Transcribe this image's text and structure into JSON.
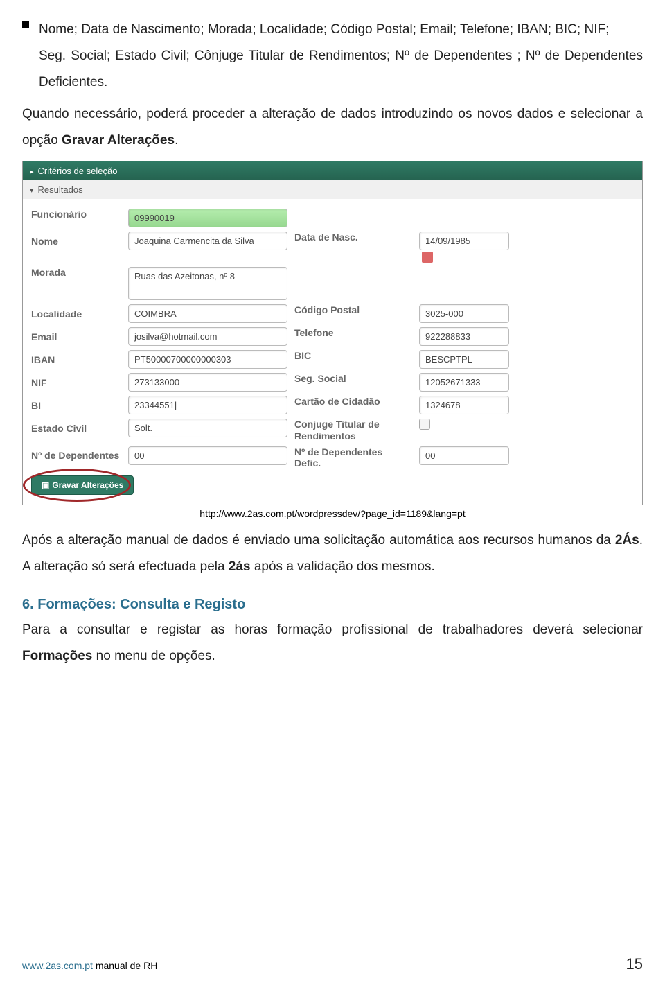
{
  "bullet1_a": "Nome; Data de Nascimento; Morada; Localidade; Código Postal; Email; Telefone; IBAN; BIC; NIF;",
  "bullet1_b": "Seg. Social; Estado Civil; Cônjuge Titular de Rendimentos; Nº de Dependentes ; Nº de Dependentes Deficientes.",
  "para2_a": "Quando necessário, poderá proceder a alteração de dados introduzindo os novos dados e selecionar a opção ",
  "para2_b": "Gravar Alterações",
  "para2_c": ".",
  "ui": {
    "header1": "Critérios de seleção",
    "header2": "Resultados",
    "labels": {
      "funcionario": "Funcionário",
      "nome": "Nome",
      "data_nasc": "Data de Nasc.",
      "morada": "Morada",
      "localidade": "Localidade",
      "cod_postal": "Código Postal",
      "email": "Email",
      "telefone": "Telefone",
      "iban": "IBAN",
      "bic": "BIC",
      "nif": "NIF",
      "seg_social": "Seg. Social",
      "bi": "BI",
      "cartao": "Cartão de Cidadão",
      "estado_civil": "Estado Civil",
      "conjuge": "Conjuge Titular de Rendimentos",
      "n_dep": "Nº de Dependentes",
      "n_dep_def": "Nº de Dependentes Defic."
    },
    "values": {
      "funcionario": "09990019",
      "nome": "Joaquina Carmencita da Silva",
      "data_nasc": "14/09/1985",
      "morada": "Ruas das Azeitonas, nº 8",
      "localidade": "COIMBRA",
      "cod_postal": "3025-000",
      "email": "josilva@hotmail.com",
      "telefone": "922288833",
      "iban": "PT50000700000000303",
      "bic": "BESCPTPL",
      "nif": "273133000",
      "seg_social": "12052671333",
      "bi": "23344551|",
      "cartao": "1324678",
      "estado_civil": "Solt.",
      "n_dep": "00",
      "n_dep_def": "00"
    },
    "save_btn": "Gravar Alterações"
  },
  "caption": "http://www.2as.com.pt/wordpressdev/?page_id=1189&lang=pt",
  "para3_a": "Após a alteração manual de dados é enviado uma solicitação automática aos recursos humanos da ",
  "para3_b": "2Ás",
  "para3_c": ". A alteração só será efectuada pela ",
  "para3_d": "2ás",
  "para3_e": " após a validação dos mesmos.",
  "heading6": "6.  Formações: Consulta e Registo",
  "para4_a": "Para a consultar e registar as horas formação profissional de trabalhadores deverá selecionar ",
  "para4_b": "Formações",
  "para4_c": " no menu de opções.",
  "footer_link": "www.2as.com.pt",
  "footer_text": "  manual de RH",
  "page_num": "15"
}
